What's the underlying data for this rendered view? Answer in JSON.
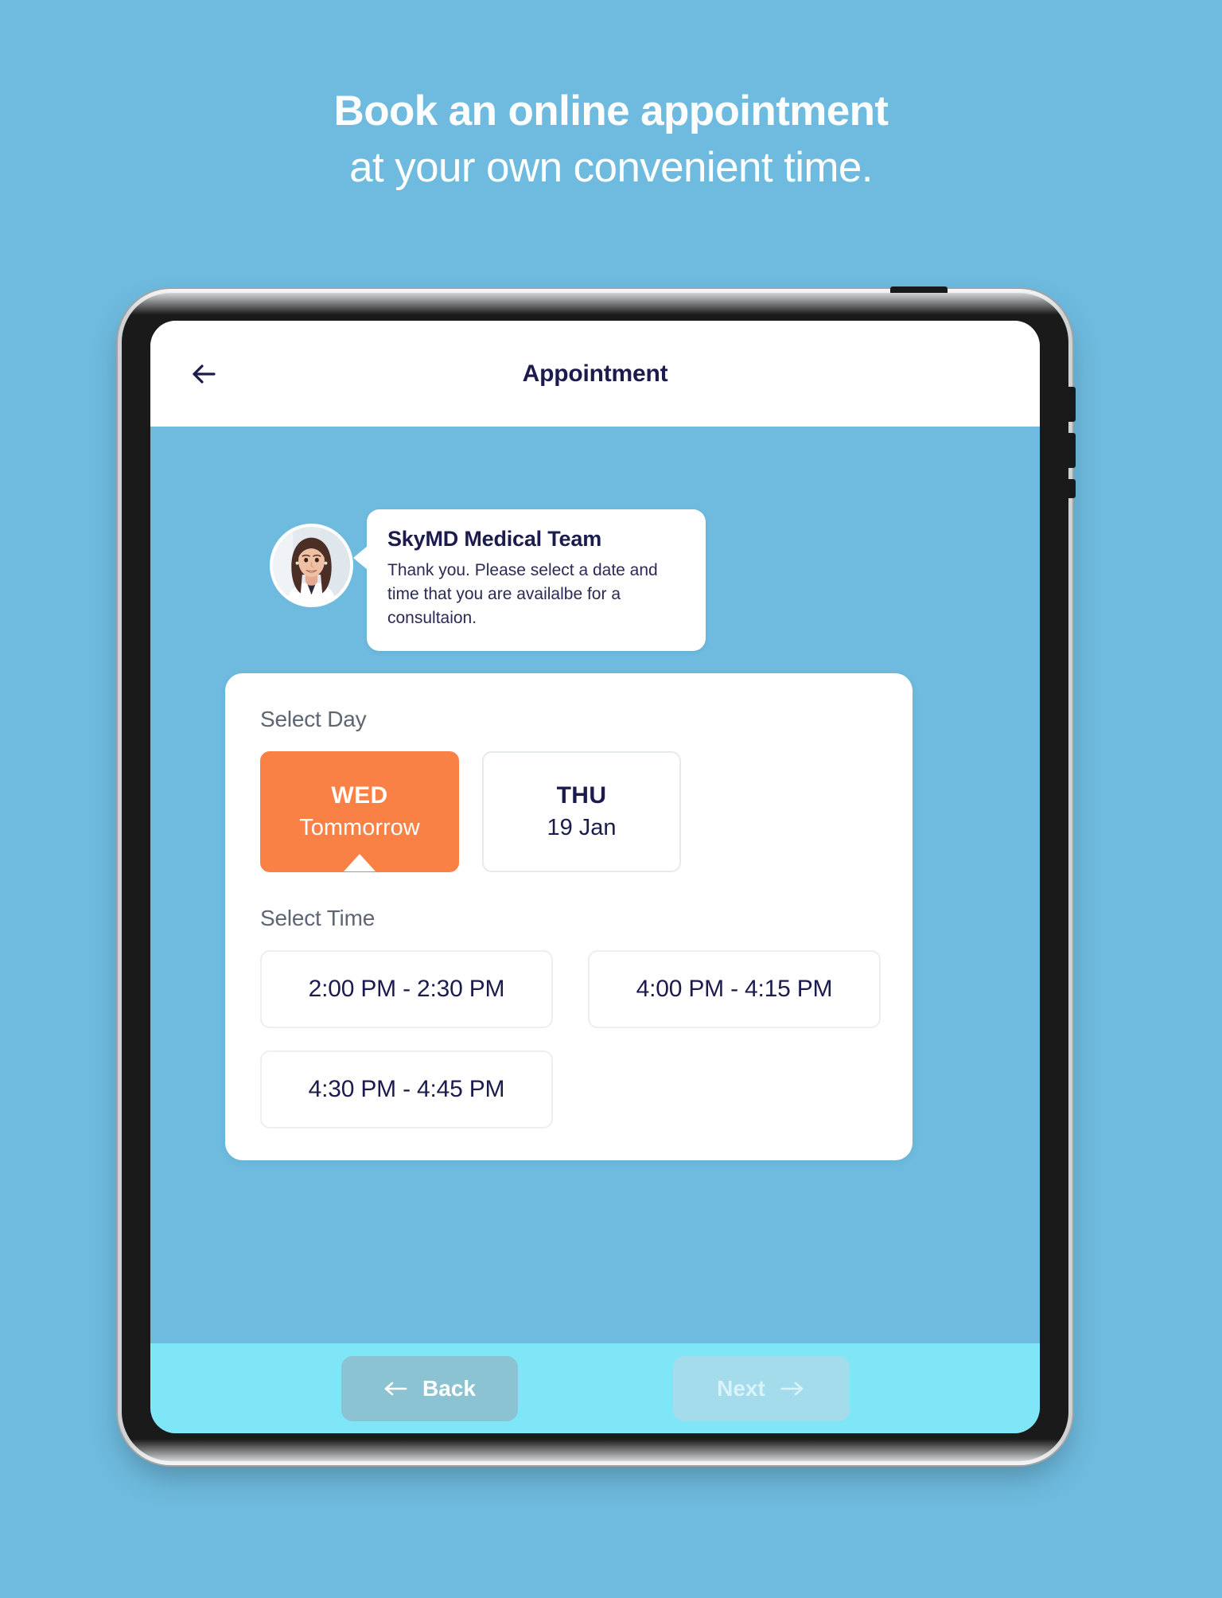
{
  "page": {
    "background_color": "#6ebbdf"
  },
  "headline": {
    "line1": "Book an online appointment",
    "line2": "at your own convenient time."
  },
  "device": {
    "type": "tablet",
    "bezel_color": "#1a1a1a",
    "rim_color": "#cfd2d4"
  },
  "app": {
    "header": {
      "title": "Appointment",
      "back_icon": "arrow-left-icon",
      "title_color": "#1b1b4d",
      "background": "#ffffff"
    },
    "chat": {
      "avatar_icon": "doctor-avatar",
      "sender": "SkyMD Medical Team",
      "message": "Thank you. Please select a date and time that you are availalbe for a consultaion."
    },
    "select_card": {
      "day_label": "Select Day",
      "days": [
        {
          "dow": "WED",
          "sub": "Tommorrow",
          "selected": true
        },
        {
          "dow": "THU",
          "sub": "19 Jan",
          "selected": false
        }
      ],
      "time_label": "Select Time",
      "times": [
        {
          "label": "2:00 PM - 2:30 PM",
          "selected": false
        },
        {
          "label": "4:00 PM - 4:15 PM",
          "selected": false
        },
        {
          "label": "4:30 PM - 4:45 PM",
          "selected": false
        }
      ],
      "selected_day_color": "#f98145",
      "card_background": "#ffffff"
    },
    "bottom_bar": {
      "background": "#7fe6f7",
      "back_label": "Back",
      "back_icon": "arrow-left-icon",
      "next_label": "Next",
      "next_icon": "arrow-right-icon",
      "next_disabled": true
    }
  }
}
